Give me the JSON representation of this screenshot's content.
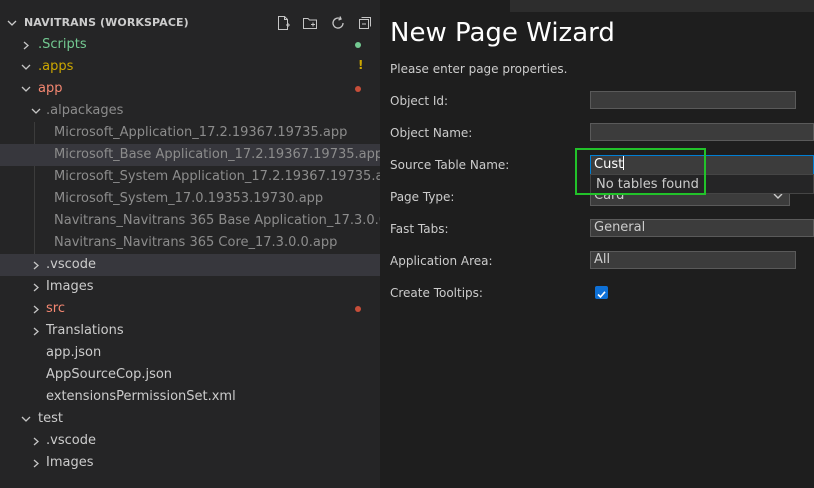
{
  "explorer": {
    "header_title": "NAVITRANS (WORKSPACE)",
    "header_icons": [
      "new-file-icon",
      "new-folder-icon",
      "refresh-icon",
      "collapse-all-icon"
    ],
    "items": [
      {
        "label": ".Scripts",
        "chevron": "right",
        "color": "#73c991",
        "badge": "dot",
        "badge_color": "#73c991"
      },
      {
        "label": ".apps",
        "chevron": "down",
        "color": "#cca700",
        "badge": "!",
        "badge_color": "#cca700"
      },
      {
        "label": "app",
        "chevron": "down",
        "color": "#f48771",
        "badge": "dot",
        "badge_color": "#c74e39"
      },
      {
        "label": ".alpackages",
        "chevron": "down",
        "color": "#8c8c8c"
      },
      {
        "label": "Microsoft_Application_17.2.19367.19735.app",
        "color": "#8c8c8c"
      },
      {
        "label": "Microsoft_Base Application_17.2.19367.19735.app",
        "color": "#8c8c8c"
      },
      {
        "label": "Microsoft_System Application_17.2.19367.19735.app",
        "color": "#8c8c8c"
      },
      {
        "label": "Microsoft_System_17.0.19353.19730.app",
        "color": "#8c8c8c"
      },
      {
        "label": "Navitrans_Navitrans 365 Base Application_17.3.0.0.app",
        "color": "#8c8c8c"
      },
      {
        "label": "Navitrans_Navitrans 365 Core_17.3.0.0.app",
        "color": "#8c8c8c"
      },
      {
        "label": ".vscode",
        "chevron": "right",
        "color": "#cccccc"
      },
      {
        "label": "Images",
        "chevron": "right",
        "color": "#cccccc"
      },
      {
        "label": "src",
        "chevron": "right",
        "color": "#f48771",
        "badge": "dot",
        "badge_color": "#c74e39"
      },
      {
        "label": "Translations",
        "chevron": "right",
        "color": "#cccccc"
      },
      {
        "label": "app.json",
        "color": "#cccccc"
      },
      {
        "label": "AppSourceCop.json",
        "color": "#cccccc"
      },
      {
        "label": "extensionsPermissionSet.xml",
        "color": "#cccccc"
      },
      {
        "label": "test",
        "chevron": "down",
        "color": "#cccccc"
      },
      {
        "label": ".vscode",
        "chevron": "right",
        "color": "#cccccc"
      },
      {
        "label": "Images",
        "chevron": "right",
        "color": "#cccccc"
      }
    ]
  },
  "wizard": {
    "title": "New Page Wizard",
    "subtitle": "Please enter page properties.",
    "fields": {
      "object_id": {
        "label": "Object Id:",
        "value": ""
      },
      "object_name": {
        "label": "Object Name:",
        "value": ""
      },
      "source_table": {
        "label": "Source Table Name:",
        "value": "Cust"
      },
      "page_type": {
        "label": "Page Type:",
        "value": "Card"
      },
      "fast_tabs": {
        "label": "Fast Tabs:",
        "value": "General"
      },
      "app_area": {
        "label": "Application Area:",
        "value": "All"
      },
      "create_tooltips": {
        "label": "Create Tooltips:",
        "checked": true
      }
    },
    "dropdown_message": "No tables found",
    "colors": {
      "accent": "#007fd4",
      "highlight": "#22c22a",
      "checkbox": "#0e70d6"
    }
  }
}
